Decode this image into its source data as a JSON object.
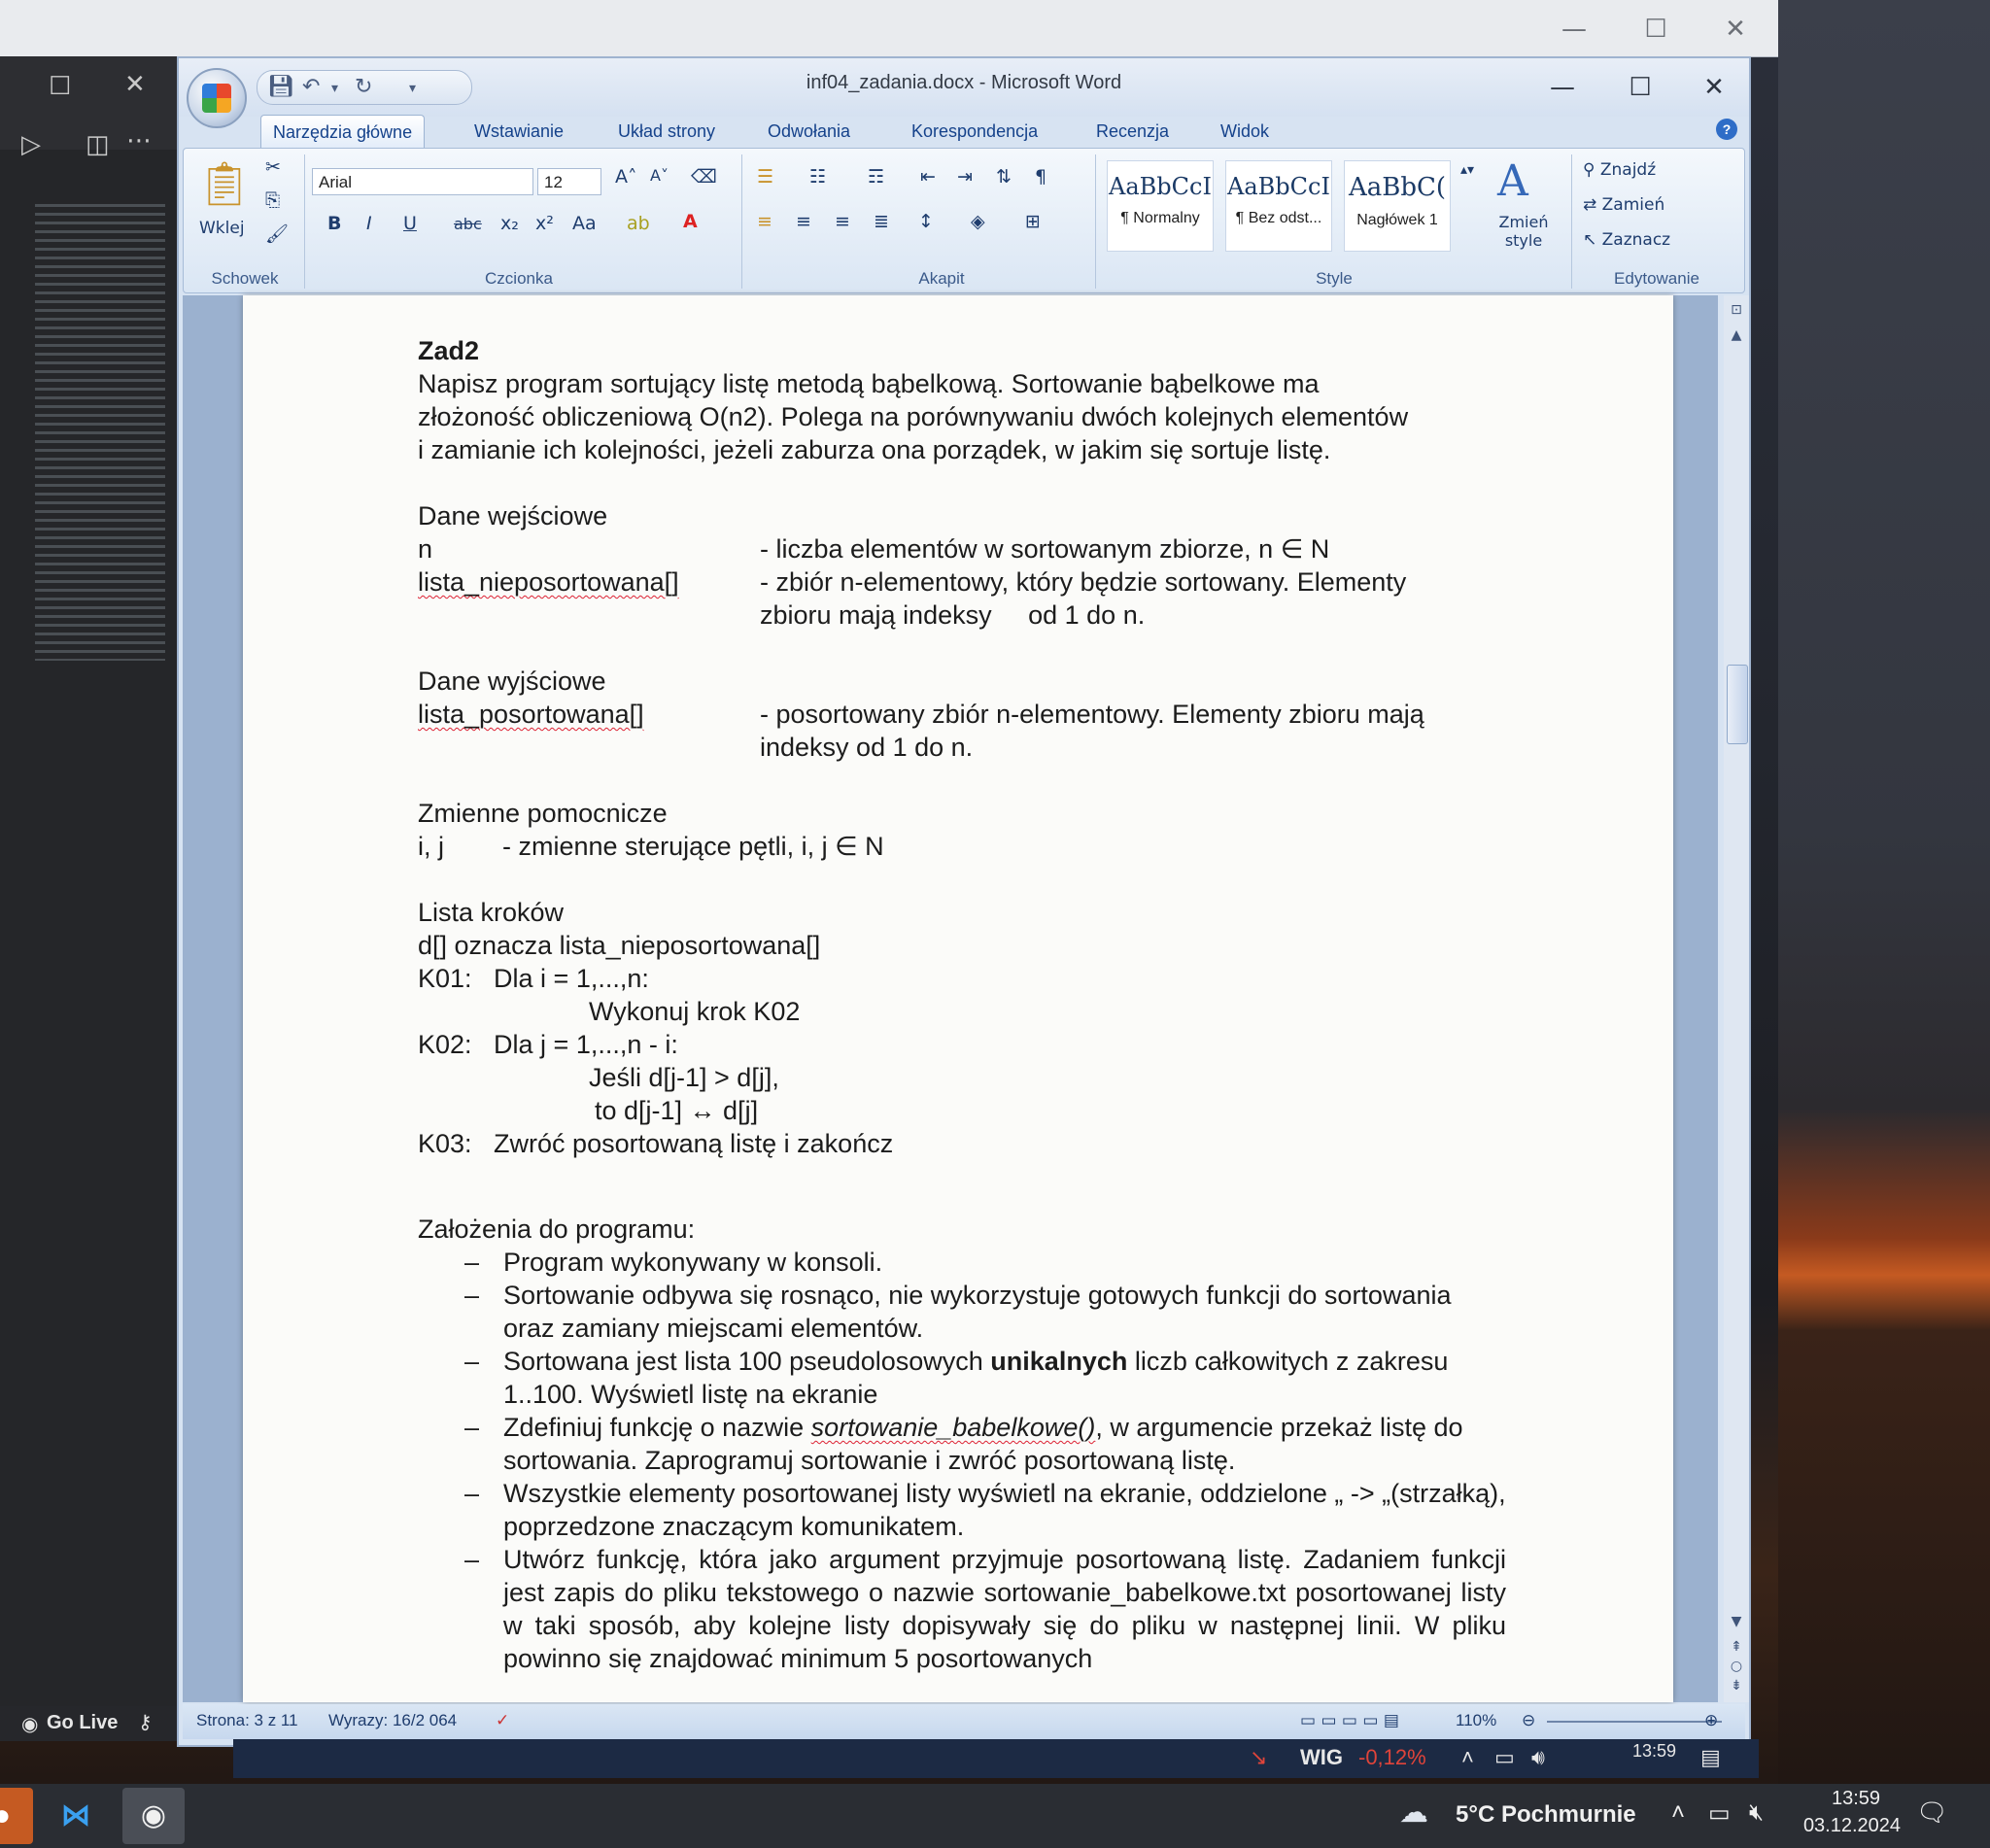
{
  "word": {
    "title": "inf04_zadania.docx - Microsoft Word",
    "tabs": [
      "Narzędzia główne",
      "Wstawianie",
      "Układ strony",
      "Odwołania",
      "Korespondencja",
      "Recenzja",
      "Widok"
    ],
    "ribbon": {
      "clipboard": {
        "paste": "Wklej",
        "label": "Schowek"
      },
      "font": {
        "name": "Arial",
        "size": "12",
        "label": "Czcionka"
      },
      "paragraph": {
        "label": "Akapit"
      },
      "styles": {
        "items": [
          {
            "sample": "AaBbCcI",
            "name": "¶ Normalny"
          },
          {
            "sample": "AaBbCcI",
            "name": "¶ Bez odst..."
          },
          {
            "sample": "AaBbC(",
            "name": "Nagłówek 1"
          }
        ],
        "change": "Zmień style",
        "label": "Style"
      },
      "editing": {
        "find": "Znajdź",
        "replace": "Zamień",
        "select": "Zaznacz",
        "label": "Edytowanie"
      }
    },
    "document": {
      "heading": "Zad2",
      "intro": [
        "Napisz program sortujący listę metodą bąbelkową. Sortowanie bąbelkowe ma",
        "złożoność obliczeniową O(n2). Polega na porównywaniu dwóch kolejnych elementów",
        "i zamianie ich kolejności, jeżeli zaburza ona porządek, w jakim się sortuje listę."
      ],
      "input_title": "Dane wejściowe",
      "input_rows": [
        {
          "name": "n",
          "desc": "- liczba elementów w sortowanym zbiorze, n ∈ N"
        },
        {
          "name": "lista_nieposortowana[]",
          "desc": "- zbiór n-elementowy, który będzie sortowany. Elementy"
        },
        {
          "name": "",
          "desc": "zbioru mają indeksy     od 1 do n."
        }
      ],
      "output_title": "Dane wyjściowe",
      "output_rows": [
        {
          "name": "lista_posortowana[]",
          "desc": "- posortowany zbiór n-elementowy. Elementy zbioru mają"
        },
        {
          "name": "",
          "desc": "indeksy od 1 do n."
        }
      ],
      "aux_title": "Zmienne pomocnicze",
      "aux_row": "i, j        - zmienne sterujące pętli, i, j ∈ N",
      "steps_title": "Lista kroków",
      "steps": [
        "d[] oznacza lista_nieposortowana[]",
        "K01:   Dla i = 1,...,n:",
        "Wykonuj krok K02",
        "K02:   Dla j = 1,...,n - i:",
        "Jeśli d[j-1] > d[j],",
        "to d[j-1] ↔ d[j]",
        "K03:   Zwróć posortowaną listę i zakończ"
      ],
      "assumptions_title": "Założenia do programu:",
      "assumptions": [
        "Program wykonywany w konsoli.",
        "Sortowanie odbywa się rosnąco, nie wykorzystuje gotowych funkcji do sortowania oraz zamiany miejscami elementów.",
        "Sortowana jest lista 100 pseudolosowych unikalnych liczb całkowitych z zakresu 1..100. Wyświetl listę na ekranie",
        "Zdefiniuj funkcję o nazwie sortowanie_babelkowe(), w argumencie przekaż listę do sortowania. Zaprogramuj sortowanie i zwróć posortowaną listę.",
        "Wszystkie elementy posortowanej listy wyświetl na ekranie, oddzielone „ -> „(strzałką), poprzedzone znaczącym komunikatem.",
        "Utwórz funkcję, która jako argument przyjmuje posortowaną listę. Zadaniem funkcji jest zapis do pliku tekstowego o nazwie sortowanie_babelkowe.txt posortowanej listy w taki sposób, aby kolejne listy dopisywały się do pliku w następnej linii. W pliku powinno się znajdować minimum 5 posortowanych"
      ],
      "a3_pre": "Sortowana jest lista 100 pseudolosowych ",
      "a3_bold": "unikalnych",
      "a3_post": " liczb całkowitych z zakresu 1..100. Wyświetl listę na ekranie",
      "a4_pre": "Zdefiniuj funkcję o nazwie ",
      "a4_ital": "sortowanie_babelkowe()",
      "a4_post": ", w argumencie przekaż listę do sortowania. Zaprogramuj sortowanie i zwróć posortowaną listę."
    },
    "status": {
      "page": "Strona: 3 z 11",
      "words": "Wyrazy: 16/2 064",
      "zoom": "110%"
    }
  },
  "vscode": {
    "go_live": "Go Live"
  },
  "inner_taskbar": {
    "ticker": "WIG",
    "change": "-0,12%",
    "time": "13:59"
  },
  "taskbar": {
    "weather": "5°C  Pochmurnie",
    "time": "13:59",
    "date": "03.12.2024"
  },
  "colors": {
    "ribbon_text": "#15428b",
    "ticker_negative": "#e0443a"
  }
}
